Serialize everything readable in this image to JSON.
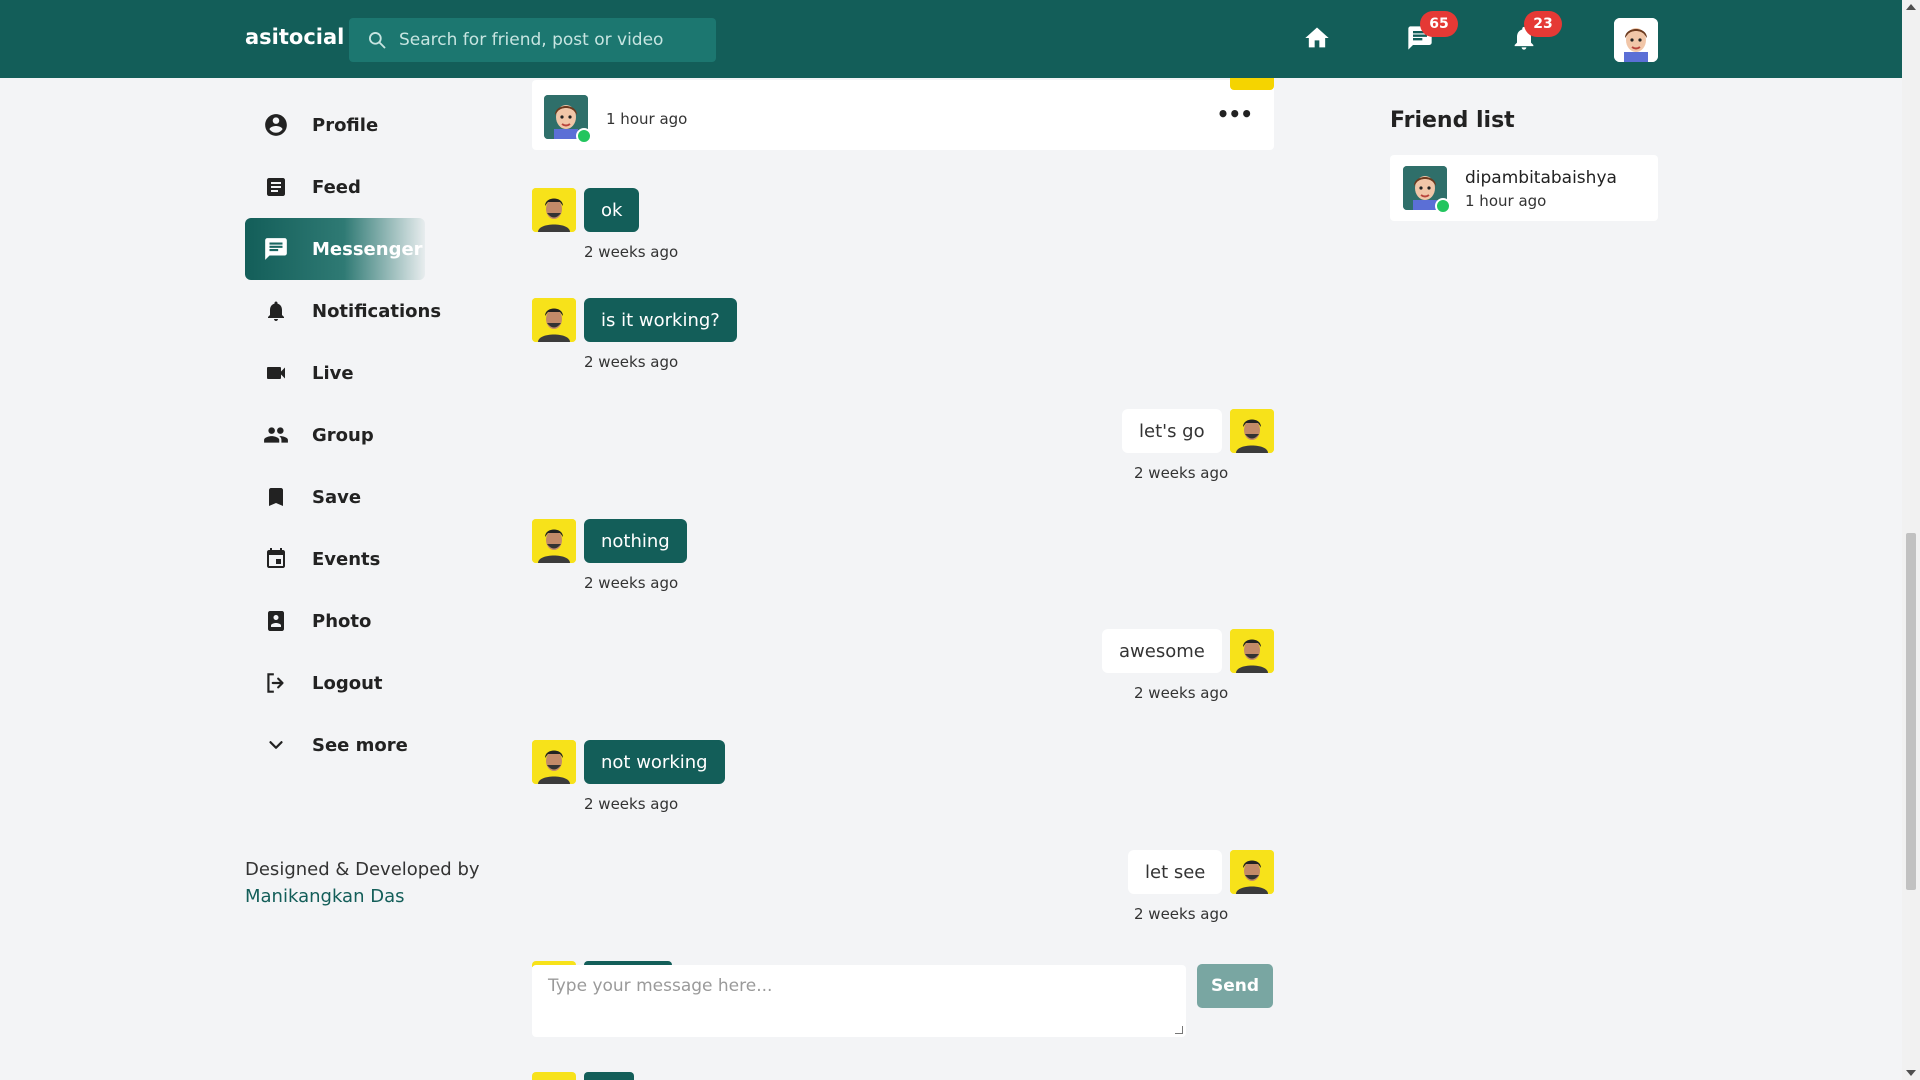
{
  "nav": {
    "brand": "asitocial",
    "search_placeholder": "Search for friend, post or video",
    "messages_badge": "65",
    "notifications_badge": "23"
  },
  "sidebar": {
    "items": [
      {
        "label": "Profile",
        "icon": "account-circle-icon"
      },
      {
        "label": "Feed",
        "icon": "article-icon"
      },
      {
        "label": "Messenger",
        "icon": "chat-icon",
        "active": true
      },
      {
        "label": "Notifications",
        "icon": "bell-icon"
      },
      {
        "label": "Live",
        "icon": "video-camera-icon"
      },
      {
        "label": "Group",
        "icon": "group-icon"
      },
      {
        "label": "Save",
        "icon": "bookmark-icon"
      },
      {
        "label": "Events",
        "icon": "calendar-icon"
      },
      {
        "label": "Photo",
        "icon": "photo-icon"
      },
      {
        "label": "Logout",
        "icon": "logout-icon"
      },
      {
        "label": "See more",
        "icon": "chevron-down-icon"
      }
    ],
    "credit_line": "Designed & Developed by",
    "credit_author": "Manikangkan Das"
  },
  "chat": {
    "header_time": "1 hour ago",
    "more_label": "•••",
    "messages": [
      {
        "text": "ok",
        "time": "2 weeks ago",
        "direction": "in"
      },
      {
        "text": "is it working?",
        "time": "2 weeks ago",
        "direction": "in"
      },
      {
        "text": "let's go",
        "time": "2 weeks ago",
        "direction": "out"
      },
      {
        "text": "nothing",
        "time": "2 weeks ago",
        "direction": "in"
      },
      {
        "text": "awesome",
        "time": "2 weeks ago",
        "direction": "out"
      },
      {
        "text": "not working",
        "time": "2 weeks ago",
        "direction": "in"
      },
      {
        "text": "let see",
        "time": "2 weeks ago",
        "direction": "out"
      }
    ],
    "compose_placeholder": "Type your message here...",
    "send_label": "Send"
  },
  "friends": {
    "title": "Friend list",
    "list": [
      {
        "name": "dipambitabaishya",
        "time": "1 hour ago"
      }
    ]
  },
  "colors": {
    "primary": "#135e59",
    "badge": "#e53935",
    "online": "#22c55e",
    "avatar_bg": "#f7e21a"
  }
}
